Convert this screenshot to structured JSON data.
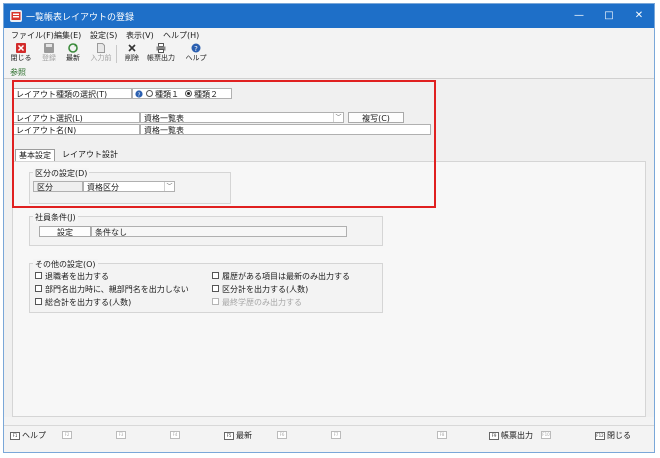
{
  "window": {
    "title": "一覧帳表レイアウトの登録",
    "controls": {
      "minimize": "—",
      "maximize": "□",
      "close": "✕"
    }
  },
  "menu": [
    "ファイル(F)",
    "編集(E)",
    "設定(S)",
    "表示(V)",
    "ヘルプ(H)"
  ],
  "toolbar": {
    "close": "閉じる",
    "register": "登録",
    "latest": "最新",
    "input_before": "入力前",
    "delete": "削除",
    "report_output": "帳票出力",
    "help": "ヘルプ"
  },
  "reference": "参照",
  "layout_type": {
    "label": "レイアウト種類の選択(T)",
    "option1": "種類１",
    "option2": "種類２",
    "selected": "option2"
  },
  "layout_select": {
    "label": "レイアウト選択(L)",
    "value": "資格一覧表",
    "copy_button": "複写(C)"
  },
  "layout_name": {
    "label": "レイアウト名(N)",
    "value": "資格一覧表"
  },
  "tabs": {
    "basic": "基本設定",
    "layout_design": "レイアウト設計"
  },
  "category_setting": {
    "title": "区分の設定(D)",
    "label": "区分",
    "value": "資格区分"
  },
  "employee_condition": {
    "title": "社員条件(J)",
    "button": "設定",
    "value": "条件なし"
  },
  "other_settings": {
    "title": "その他の設定(O)",
    "options": [
      {
        "label": "退職者を出力する",
        "checked": false,
        "enabled": true
      },
      {
        "label": "部門名出力時に、親部門名を出力しない",
        "checked": false,
        "enabled": true
      },
      {
        "label": "総合計を出力する(人数)",
        "checked": false,
        "enabled": true
      },
      {
        "label": "履歴がある項目は最新のみ出力する",
        "checked": false,
        "enabled": true
      },
      {
        "label": "区分計を出力する(人数)",
        "checked": false,
        "enabled": true
      },
      {
        "label": "最終学歴のみ出力する",
        "checked": false,
        "enabled": false
      }
    ]
  },
  "fkeys": [
    {
      "key": "F1",
      "label": "ヘルプ"
    },
    {
      "key": "F2",
      "label": ""
    },
    {
      "key": "F3",
      "label": ""
    },
    {
      "key": "F4",
      "label": ""
    },
    {
      "key": "F5",
      "label": "最新"
    },
    {
      "key": "F6",
      "label": ""
    },
    {
      "key": "F7",
      "label": ""
    },
    {
      "key": "F8",
      "label": ""
    },
    {
      "key": "F9",
      "label": "帳票出力"
    },
    {
      "key": "F10",
      "label": ""
    },
    {
      "key": "F12",
      "label": "閉じる"
    }
  ],
  "colors": {
    "titlebar": "#1e6fc8",
    "highlight": "#e02020",
    "help_icon": "#2a5fb0"
  }
}
